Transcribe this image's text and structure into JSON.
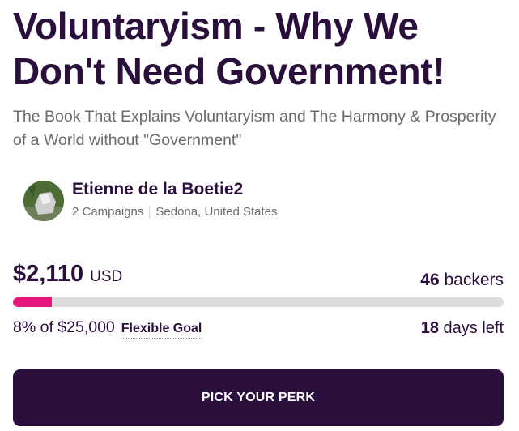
{
  "campaign": {
    "title": "Voluntaryism - Why We Don't Need Government!",
    "subtitle": "The Book That Explains Voluntaryism and The Harmony & Prosperity of a World without \"Government\""
  },
  "owner": {
    "name": "Etienne de la Boetie2",
    "campaigns": "2 Campaigns",
    "location": "Sedona, United States"
  },
  "funding": {
    "amount": "$2,110",
    "currency": "USD",
    "backers_count": "46",
    "backers_label": "backers",
    "progress_percent": 8,
    "goal_text": "8% of $25,000",
    "goal_type": "Flexible Goal",
    "days_count": "18",
    "days_label": "days left"
  },
  "cta": {
    "label": "PICK YOUR PERK"
  },
  "colors": {
    "primary": "#2a0f3d",
    "progress": "#e5177f",
    "track": "#dcdcdc",
    "muted_text": "#6b6b6b"
  }
}
